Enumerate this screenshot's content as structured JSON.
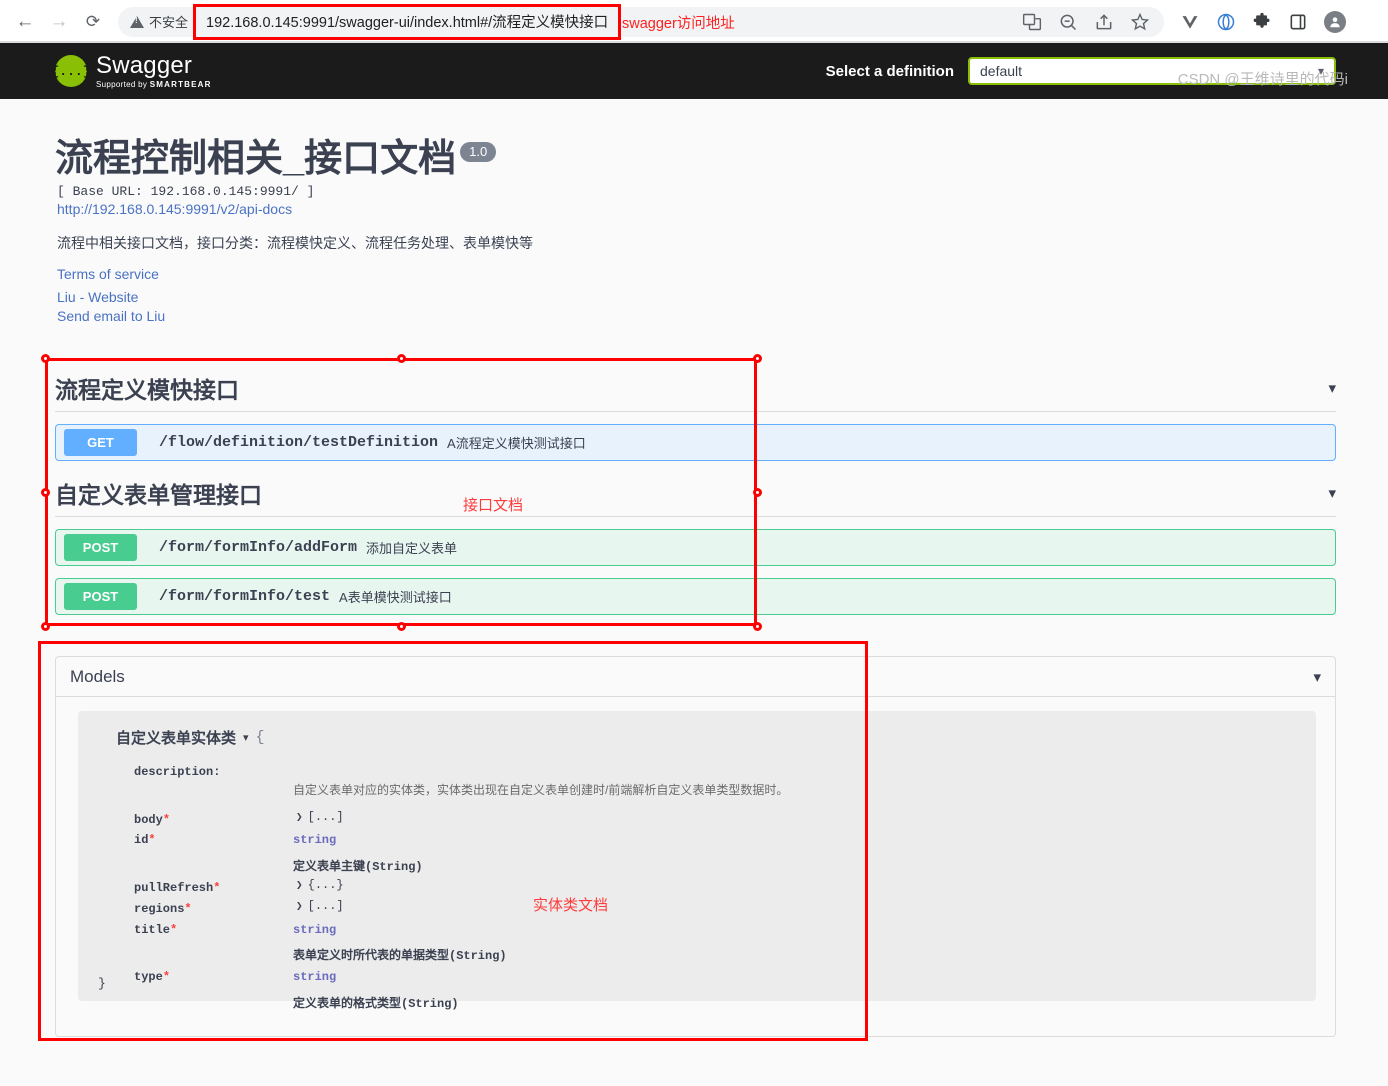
{
  "browser": {
    "back_icon": "arrow-left-icon",
    "forward_icon": "arrow-right-icon",
    "reload_icon": "reload-icon",
    "security_label": "不安全",
    "url_host": "192.168.0.145",
    "url_rest": ":9991/swagger-ui/index.html#/流程定义模快接口",
    "url_full": "192.168.0.145:9991/swagger-ui/index.html#/流程定义模快接口",
    "url_annotation": "swagger访问地址",
    "toolbar_icons": [
      "translate-icon",
      "zoom-out-icon",
      "share-icon",
      "bookmark-star-icon",
      "vimium-v-icon",
      "opera-circle-icon",
      "extensions-puzzle-icon",
      "side-panel-icon",
      "profile-avatar-icon"
    ]
  },
  "topbar": {
    "logo_glyph": "{...}",
    "logo_title": "Swagger",
    "logo_sub_prefix": "Supported by ",
    "logo_sub_brand": "SMARTBEAR",
    "definition_label": "Select a definition",
    "definition_value": "default",
    "chevron_icon": "chevron-down-icon"
  },
  "info": {
    "title": "流程控制相关_接口文档",
    "version": "1.0",
    "base_url": "[ Base URL: 192.168.0.145:9991/ ]",
    "api_docs_link": "http://192.168.0.145:9991/v2/api-docs",
    "description": "流程中相关接口文档，接口分类：流程模快定义、流程任务处理、表单模快等",
    "terms_of_service": "Terms of service",
    "website_link": "Liu - Website",
    "email_link": "Send email to Liu"
  },
  "tags": [
    {
      "name": "流程定义模快接口",
      "operations": [
        {
          "verb": "GET",
          "path": "/flow/definition/testDefinition",
          "summary": "A流程定义模快测试接口"
        }
      ]
    },
    {
      "name": "自定义表单管理接口",
      "operations": [
        {
          "verb": "POST",
          "path": "/form/formInfo/addForm",
          "summary": "添加自定义表单"
        },
        {
          "verb": "POST",
          "path": "/form/formInfo/test",
          "summary": "A表单模快测试接口"
        }
      ]
    }
  ],
  "models": {
    "section_title": "Models",
    "model_name": "自定义表单实体类",
    "open_brace": "{",
    "close_brace": "}",
    "description_label": "description:",
    "description_value": "自定义表单对应的实体类，实体类出现在自定义表单创建时/前端解析自定义表单类型数据时。",
    "properties": [
      {
        "name": "body",
        "required": "*",
        "value": "[...]",
        "kind": "collapsed-array",
        "arrow": "❯",
        "desc": ""
      },
      {
        "name": "id",
        "required": "*",
        "value": "string",
        "kind": "type",
        "desc": "定义表单主键(String)"
      },
      {
        "name": "pullRefresh",
        "required": "*",
        "value": "{...}",
        "kind": "collapsed-object",
        "arrow": "❯",
        "desc": ""
      },
      {
        "name": "regions",
        "required": "*",
        "value": "[...]",
        "kind": "collapsed-array",
        "arrow": "❯",
        "desc": ""
      },
      {
        "name": "title",
        "required": "*",
        "value": "string",
        "kind": "type",
        "desc": "表单定义时所代表的单据类型(String)"
      },
      {
        "name": "type",
        "required": "*",
        "value": "string",
        "kind": "type",
        "desc": "定义表单的格式类型(String)"
      }
    ]
  },
  "annotations": {
    "api_doc_note": "接口文档",
    "entity_doc_note": "实体类文档"
  },
  "watermark": "CSDN @王维诗里的代码i",
  "colors": {
    "get": "#61affe",
    "post": "#49cc90",
    "swagger_green": "#89bf04",
    "annotation_red": "#ff0000",
    "topbar_dark": "#1b1b1b"
  }
}
